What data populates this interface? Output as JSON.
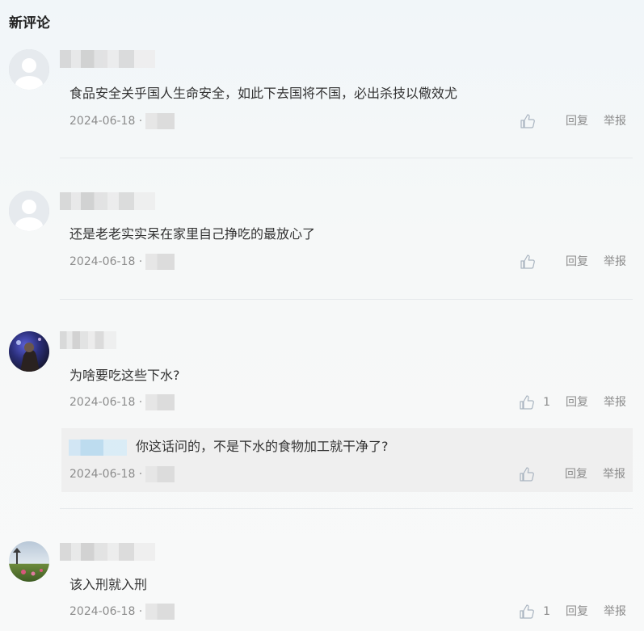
{
  "section_title": "新评论",
  "actions": {
    "reply": "回复",
    "report": "举报"
  },
  "comments": [
    {
      "username": "用户",
      "text": "食品安全关乎国人生命安全，如此下去国将不国，必出杀技以儆效尤",
      "date": "2024-06-18 ·",
      "location": "",
      "likes": ""
    },
    {
      "username": "用户",
      "text": "还是老老实实呆在家里自己挣吃的最放心了",
      "date": "2024-06-18 ·",
      "location": "",
      "likes": ""
    },
    {
      "username": "用户",
      "text": "为啥要吃这些下水?",
      "date": "2024-06-18 ·",
      "location": "",
      "likes": "1",
      "reply": {
        "username": "用户",
        "text": "你这话问的，不是下水的食物加工就干净了?",
        "date": "2024-06-18 ·",
        "location": "",
        "likes": ""
      }
    },
    {
      "username": "用户",
      "text": "该入刑就入刑",
      "date": "2024-06-18 ·",
      "location": "",
      "likes": "1"
    }
  ],
  "colors": {
    "accent": "#8c8c8c",
    "reply_bg": "#efefef"
  },
  "icons": {
    "like": "thumbs-up-icon",
    "avatar_default": "default-avatar-icon"
  }
}
